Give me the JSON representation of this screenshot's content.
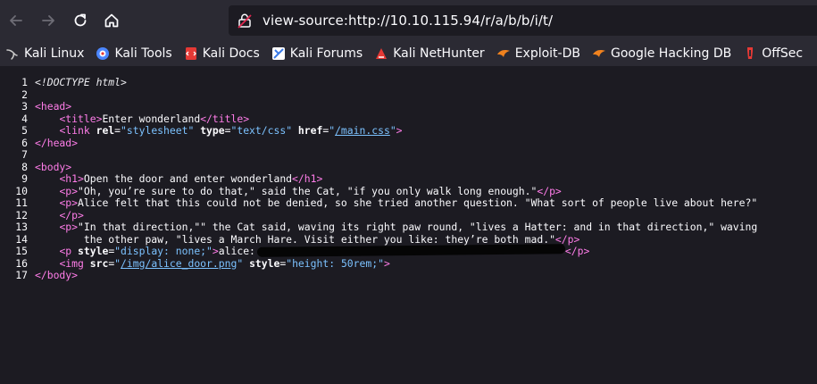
{
  "url": "view-source:http://10.10.115.94/r/a/b/b/i/t/",
  "bookmarks": [
    {
      "label": "Kali Linux",
      "icon": "kali-dragon-icon",
      "color": "#cccccc"
    },
    {
      "label": "Kali Tools",
      "icon": "kali-tools-icon",
      "color": "#4b86ff"
    },
    {
      "label": "Kali Docs",
      "icon": "kali-docs-icon",
      "color": "#e53935"
    },
    {
      "label": "Kali Forums",
      "icon": "kali-forums-icon",
      "color": "#3b7be8"
    },
    {
      "label": "Kali NetHunter",
      "icon": "kali-nethunter-icon",
      "color": "#e53935"
    },
    {
      "label": "Exploit-DB",
      "icon": "exploit-db-icon",
      "color": "#f0821e"
    },
    {
      "label": "Google Hacking DB",
      "icon": "ghdb-icon",
      "color": "#f0821e"
    },
    {
      "label": "OffSec",
      "icon": "offsec-icon",
      "color": "#e53935"
    }
  ],
  "source": {
    "l1": "<!DOCTYPE html>",
    "l4_title": "Enter wonderland",
    "l5_rel": "\"stylesheet\"",
    "l5_type": "\"text/css\"",
    "l5_href": "/main.css",
    "l9_h1": "Open the door and enter wonderland",
    "l10_text": "\"Oh, you’re sure to do that,\" said the Cat, \"if you only walk long enough.\"",
    "l11_text": "Alice felt that this could not be denied, so she tried another question. \"What sort of people live about here?\"",
    "l13_text_a": "\"In that direction,\"\" the Cat said, waving its right paw round, \"lives a Hatter: and in that direction,\" waving",
    "l13_text_b": "the other paw, \"lives a March Hare. Visit either you like: they’re both mad.\"",
    "l15_style": "\"display: none;\"",
    "l15_text": "alice:",
    "l16_src": "/img/alice_door.png",
    "l16_style": "\"height: 50rem;\""
  }
}
